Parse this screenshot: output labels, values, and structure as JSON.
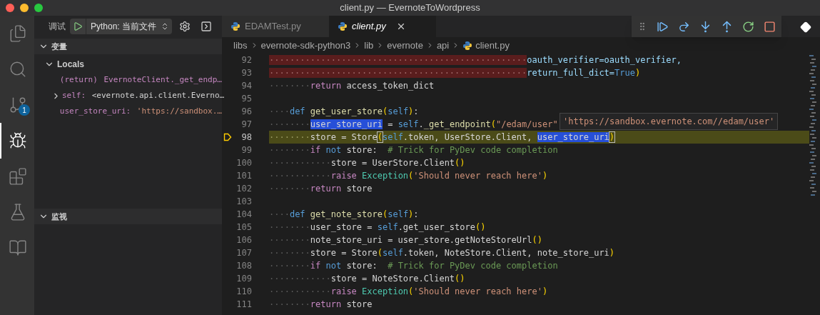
{
  "window": {
    "title": "client.py — EvernoteToWordpress"
  },
  "activity_bar": [
    {
      "kind": "files",
      "selected": false
    },
    {
      "kind": "search",
      "selected": false
    },
    {
      "kind": "git",
      "selected": false,
      "badge": "1"
    },
    {
      "kind": "debug",
      "selected": true
    },
    {
      "kind": "extensions",
      "selected": false
    },
    {
      "kind": "test",
      "selected": false
    },
    {
      "kind": "book",
      "selected": false
    }
  ],
  "debug_header": {
    "label": "调试",
    "configuration": "Python: 当前文件"
  },
  "variables": {
    "title": "变量",
    "expanded": true,
    "scopes": [
      {
        "name": "Locals",
        "expanded": true,
        "children": [
          {
            "kind": "return",
            "name": "(return)",
            "value": "EvernoteClient._get_endp…",
            "expandable": false
          },
          {
            "kind": "object",
            "name": "self:",
            "value": "<evernote.api.client.Everno…",
            "expandable": true,
            "expanded": false
          },
          {
            "kind": "string",
            "name": "user_store_uri:",
            "value": "'https://sandbox.…",
            "expandable": false
          }
        ]
      }
    ]
  },
  "watch": {
    "title": "监视",
    "expanded": true
  },
  "tabs": [
    {
      "label": "EDAMTest.py",
      "selected": false
    },
    {
      "label": "client.py",
      "selected": true
    }
  ],
  "breadcrumb": [
    "libs",
    "evernote-sdk-python3",
    "lib",
    "evernote",
    "api",
    "client.py"
  ],
  "lines": [
    {
      "number": "92",
      "current": false,
      "error": true,
      "tokens": [
        {
          "kind": "ws",
          "text": "··················································"
        },
        {
          "kind": "param",
          "text": "oauth_verifier=oauth_verifier,"
        }
      ]
    },
    {
      "number": "93",
      "current": false,
      "error": true,
      "tokens": [
        {
          "kind": "ws",
          "text": "··················································"
        },
        {
          "kind": "param",
          "text": "return_full_dict="
        },
        {
          "kind": "const",
          "text": "True"
        },
        {
          "kind": "paren",
          "text": ")"
        }
      ]
    },
    {
      "number": "94",
      "current": false,
      "error": false,
      "tokens": [
        {
          "kind": "ws",
          "text": "········"
        },
        {
          "kind": "kw",
          "text": "return"
        },
        {
          "kind": "p",
          "text": " access_token_dict"
        }
      ]
    },
    {
      "number": "95"
    },
    {
      "number": "96",
      "current": false,
      "error": false,
      "tokens": [
        {
          "kind": "ws",
          "text": "····"
        },
        {
          "kind": "def",
          "text": "def"
        },
        {
          "kind": "fn",
          "text": " get_user_store"
        },
        {
          "kind": "paren",
          "text": "("
        },
        {
          "kind": "self",
          "text": "self"
        },
        {
          "kind": "paren",
          "text": ")"
        },
        {
          "kind": "p",
          "text": ":"
        }
      ]
    },
    {
      "number": "97",
      "current": false,
      "error": false,
      "tokens": [
        {
          "kind": "ws",
          "text": "········"
        },
        {
          "kind": "sel",
          "text": "user_store_uri"
        },
        {
          "kind": "p",
          "text": " = "
        },
        {
          "kind": "self",
          "text": "self"
        },
        {
          "kind": "p",
          "text": "."
        },
        {
          "kind": "fn",
          "text": "_get_endpoint"
        },
        {
          "kind": "paren",
          "text": "("
        },
        {
          "kind": "str",
          "text": "\"/edam/user\""
        }
      ]
    },
    {
      "number": "98",
      "current": true,
      "error": false,
      "tokens": [
        {
          "kind": "ws",
          "text": "········"
        },
        {
          "kind": "p",
          "text": "store = Store"
        },
        {
          "kind": "match",
          "text": "("
        },
        {
          "kind": "self",
          "text": "self"
        },
        {
          "kind": "p",
          "text": ".token, UserStore.Client, "
        },
        {
          "kind": "sel",
          "text": "user_store_uri"
        },
        {
          "kind": "match",
          "text": ")"
        }
      ]
    },
    {
      "number": "99",
      "current": false,
      "error": false,
      "tokens": [
        {
          "kind": "ws",
          "text": "········"
        },
        {
          "kind": "kw",
          "text": "if"
        },
        {
          "kind": "def",
          "text": " not"
        },
        {
          "kind": "p",
          "text": " store:  "
        },
        {
          "kind": "cm",
          "text": "# Trick for PyDev code completion"
        }
      ]
    },
    {
      "number": "100",
      "current": false,
      "error": false,
      "tokens": [
        {
          "kind": "ws",
          "text": "············"
        },
        {
          "kind": "p",
          "text": "store = UserStore.Client"
        },
        {
          "kind": "paren",
          "text": "()"
        }
      ]
    },
    {
      "number": "101",
      "current": false,
      "error": false,
      "tokens": [
        {
          "kind": "ws",
          "text": "············"
        },
        {
          "kind": "kw",
          "text": "raise"
        },
        {
          "kind": "cls",
          "text": " Exception"
        },
        {
          "kind": "paren",
          "text": "("
        },
        {
          "kind": "str",
          "text": "'Should never reach here'"
        },
        {
          "kind": "paren",
          "text": ")"
        }
      ]
    },
    {
      "number": "102",
      "current": false,
      "error": false,
      "tokens": [
        {
          "kind": "ws",
          "text": "········"
        },
        {
          "kind": "kw",
          "text": "return"
        },
        {
          "kind": "p",
          "text": " store"
        }
      ]
    },
    {
      "number": "103"
    },
    {
      "number": "104",
      "current": false,
      "error": false,
      "tokens": [
        {
          "kind": "ws",
          "text": "····"
        },
        {
          "kind": "def",
          "text": "def"
        },
        {
          "kind": "fn",
          "text": " get_note_store"
        },
        {
          "kind": "paren",
          "text": "("
        },
        {
          "kind": "self",
          "text": "self"
        },
        {
          "kind": "paren",
          "text": ")"
        },
        {
          "kind": "p",
          "text": ":"
        }
      ]
    },
    {
      "number": "105",
      "current": false,
      "error": false,
      "tokens": [
        {
          "kind": "ws",
          "text": "········"
        },
        {
          "kind": "p",
          "text": "user_store = "
        },
        {
          "kind": "self",
          "text": "self"
        },
        {
          "kind": "p",
          "text": ".get_user_store"
        },
        {
          "kind": "paren",
          "text": "()"
        }
      ]
    },
    {
      "number": "106",
      "current": false,
      "error": false,
      "tokens": [
        {
          "kind": "ws",
          "text": "········"
        },
        {
          "kind": "p",
          "text": "note_store_uri = user_store.getNoteStoreUrl"
        },
        {
          "kind": "paren",
          "text": "()"
        }
      ]
    },
    {
      "number": "107",
      "current": false,
      "error": false,
      "tokens": [
        {
          "kind": "ws",
          "text": "········"
        },
        {
          "kind": "p",
          "text": "store = Store"
        },
        {
          "kind": "paren",
          "text": "("
        },
        {
          "kind": "self",
          "text": "self"
        },
        {
          "kind": "p",
          "text": ".token, NoteStore.Client, note_store_uri"
        },
        {
          "kind": "paren",
          "text": ")"
        }
      ]
    },
    {
      "number": "108",
      "current": false,
      "error": false,
      "tokens": [
        {
          "kind": "ws",
          "text": "········"
        },
        {
          "kind": "kw",
          "text": "if"
        },
        {
          "kind": "def",
          "text": " not"
        },
        {
          "kind": "p",
          "text": " store:  "
        },
        {
          "kind": "cm",
          "text": "# Trick for PyDev code completion"
        }
      ]
    },
    {
      "number": "109",
      "current": false,
      "error": false,
      "tokens": [
        {
          "kind": "ws",
          "text": "············"
        },
        {
          "kind": "p",
          "text": "store = NoteStore.Client"
        },
        {
          "kind": "paren",
          "text": "()"
        }
      ]
    },
    {
      "number": "110",
      "current": false,
      "error": false,
      "tokens": [
        {
          "kind": "ws",
          "text": "············"
        },
        {
          "kind": "kw",
          "text": "raise"
        },
        {
          "kind": "cls",
          "text": " Exception"
        },
        {
          "kind": "paren",
          "text": "("
        },
        {
          "kind": "str",
          "text": "'Should never reach here'"
        },
        {
          "kind": "paren",
          "text": ")"
        }
      ]
    },
    {
      "number": "111",
      "current": false,
      "error": false,
      "tokens": [
        {
          "kind": "ws",
          "text": "········"
        },
        {
          "kind": "kw",
          "text": "return"
        },
        {
          "kind": "p",
          "text": " store"
        }
      ]
    }
  ],
  "hover": {
    "text": "'https://sandbox.evernote.com//edam/user'"
  },
  "debug_toolbar": [
    {
      "kind": "continue"
    },
    {
      "kind": "step_over"
    },
    {
      "kind": "step_into"
    },
    {
      "kind": "step_out"
    },
    {
      "kind": "restart"
    },
    {
      "kind": "stop"
    }
  ]
}
